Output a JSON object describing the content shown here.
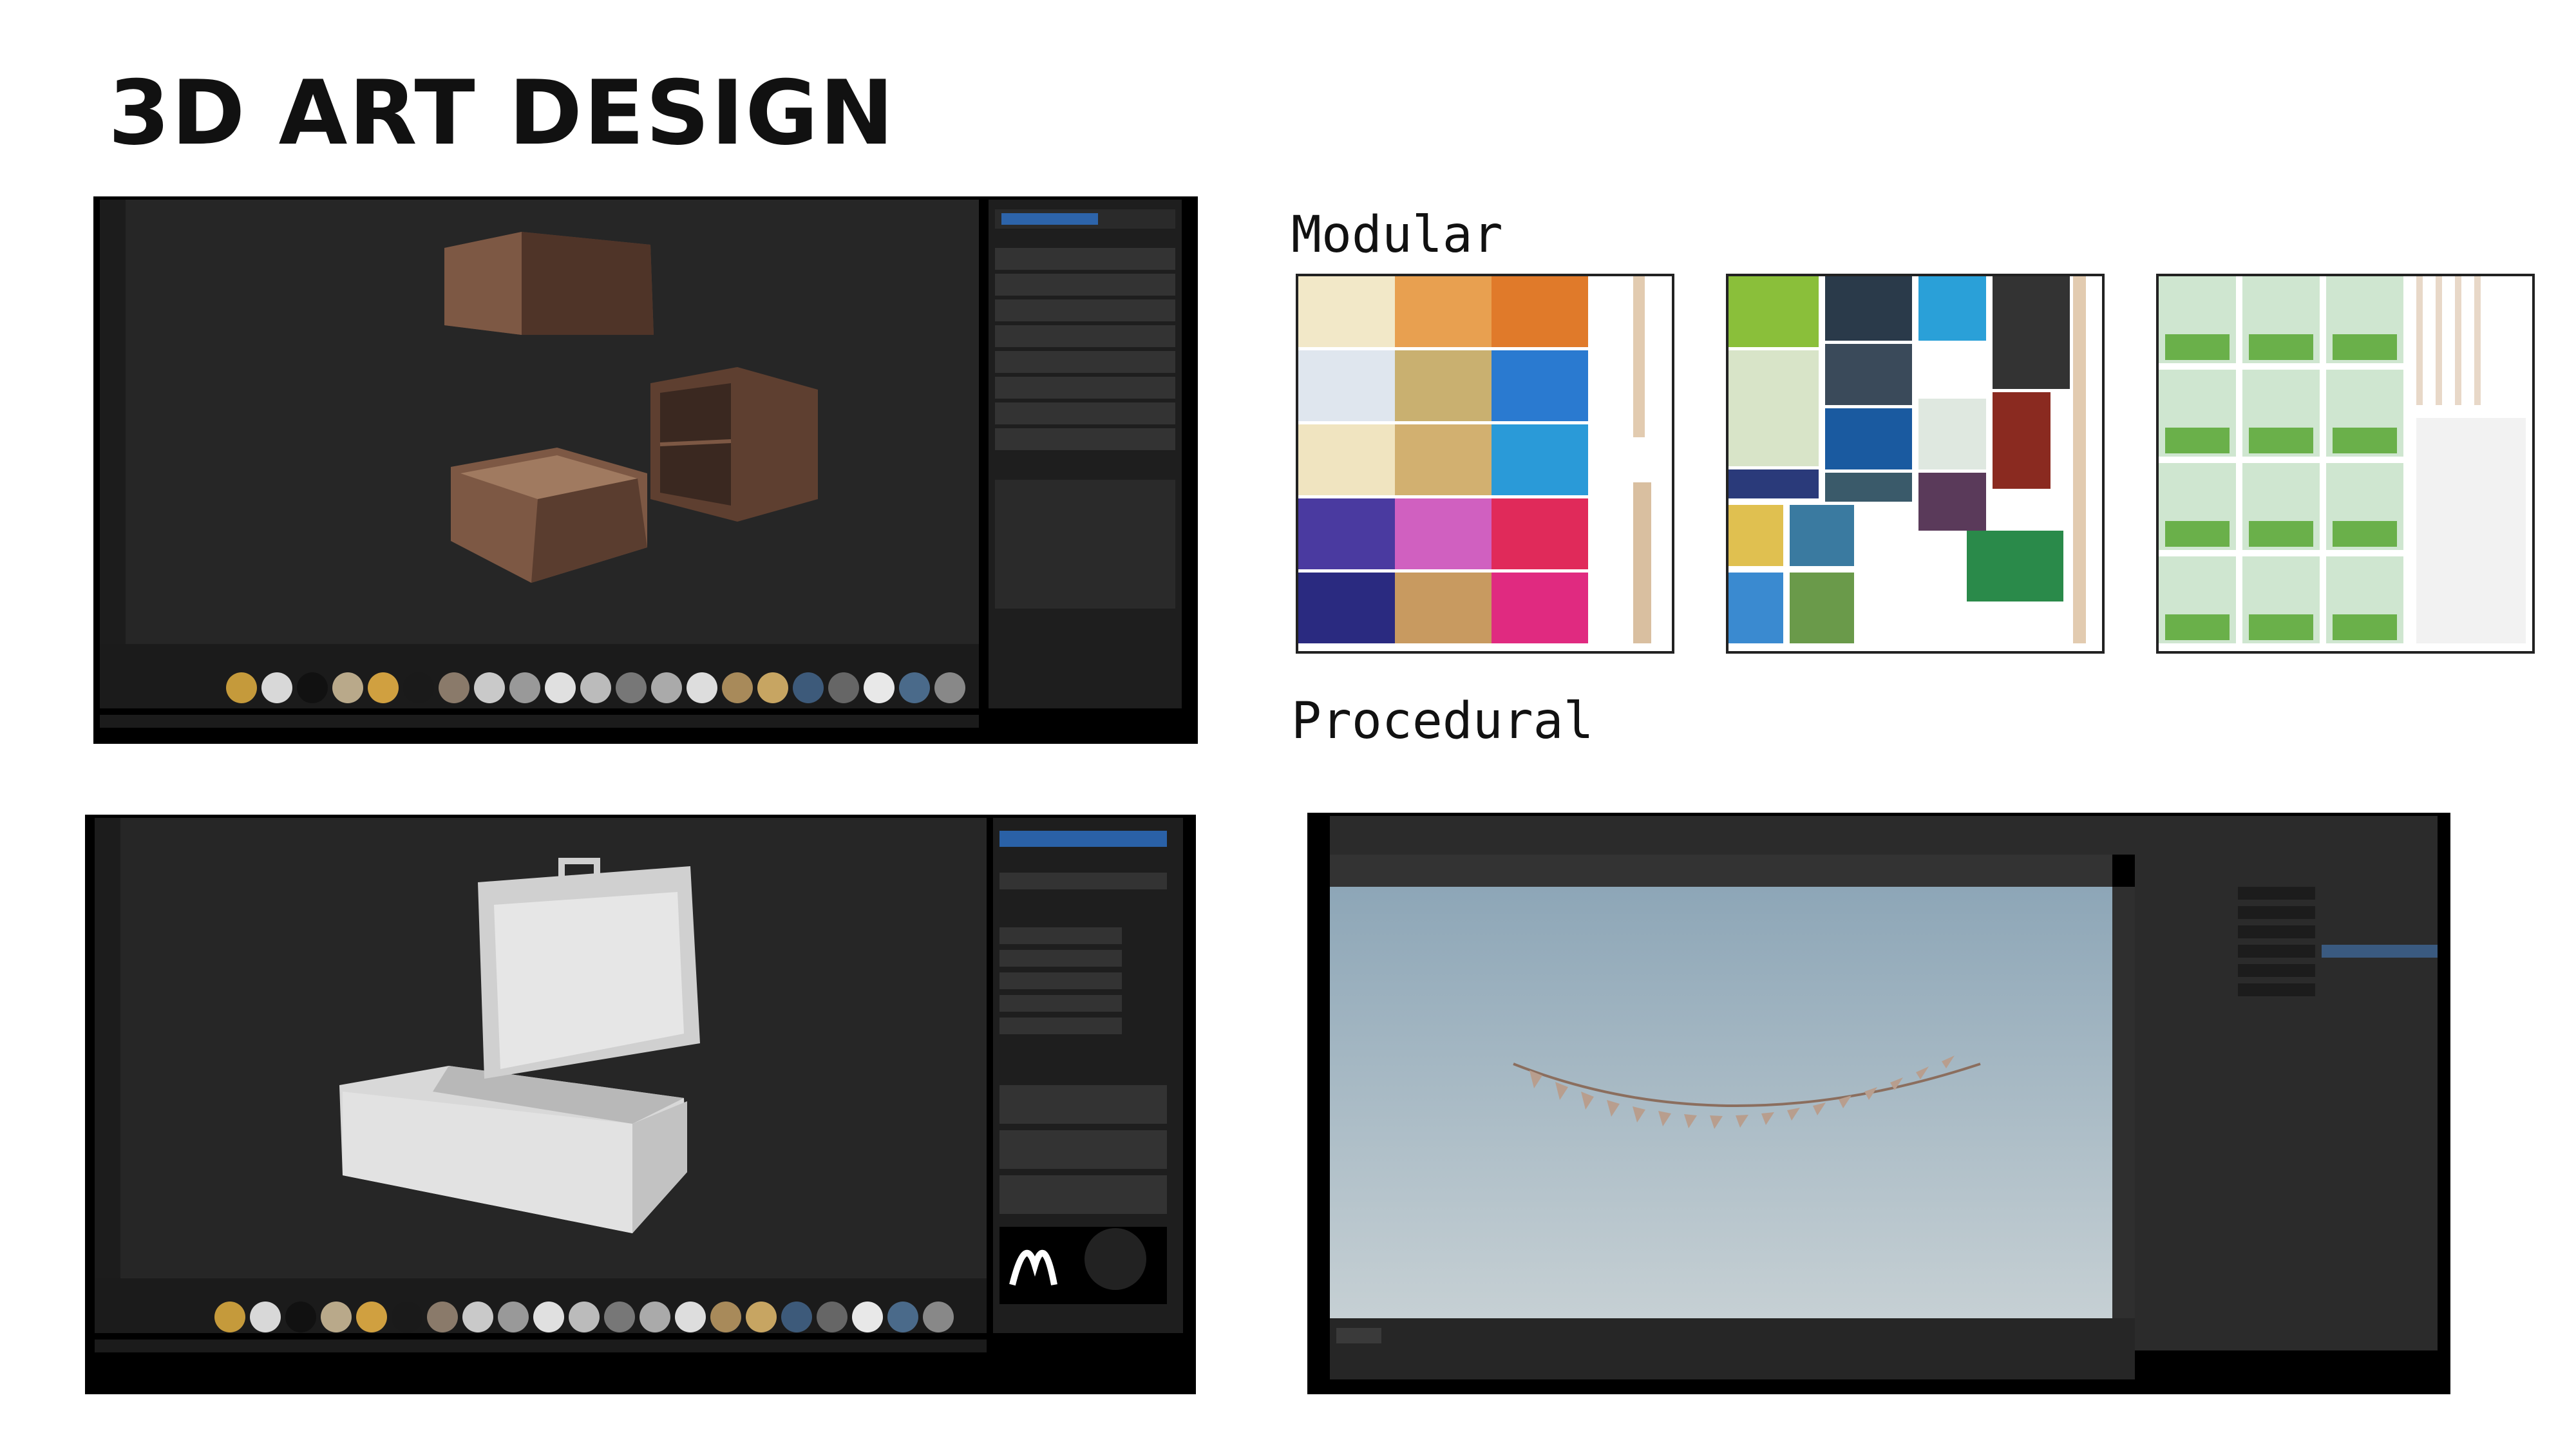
{
  "slide": {
    "title": "3D ART DESIGN",
    "labels": {
      "modular": "Modular",
      "procedural": "Procedural"
    }
  },
  "colors": {
    "title_text": "#111111",
    "app_bg": "#262626",
    "panel_bg": "#1e1e1e",
    "accent_blue": "#2f7de1",
    "wood": "#6b4a3a",
    "viewport_top": "#8da6b7",
    "viewport_bottom": "#c6d0d4"
  },
  "screens": [
    {
      "name": "drawer-cabinet-texturing",
      "subject": "wood cabinet and drawers"
    },
    {
      "name": "open-box-model",
      "subject": "open box with lid"
    },
    {
      "name": "procedural-bunting",
      "subject": "string of flags"
    }
  ],
  "texture_sheets": [
    {
      "name": "sheet-cartoon-covers"
    },
    {
      "name": "sheet-mixed-covers"
    },
    {
      "name": "sheet-green-covers"
    }
  ]
}
